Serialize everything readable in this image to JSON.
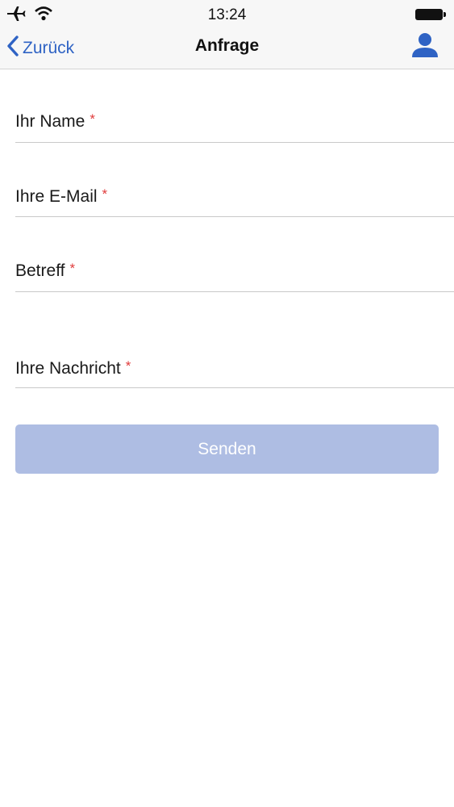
{
  "status_bar": {
    "time": "13:24",
    "icons": [
      "airplane-icon",
      "wifi-icon",
      "battery-icon"
    ]
  },
  "nav": {
    "back_label": "Zurück",
    "title": "Anfrage",
    "profile_icon": "person-icon"
  },
  "form": {
    "required_marker": "*",
    "fields": [
      {
        "label": "Ihr Name",
        "value": ""
      },
      {
        "label": "Ihre E-Mail",
        "value": ""
      },
      {
        "label": "Betreff",
        "value": ""
      },
      {
        "label": "Ihre Nachricht",
        "value": ""
      }
    ],
    "submit_label": "Senden"
  },
  "colors": {
    "accent": "#2f63c4",
    "required": "#e03b3b",
    "button_disabled": "#aebde3",
    "bar_background": "#f7f7f7"
  }
}
